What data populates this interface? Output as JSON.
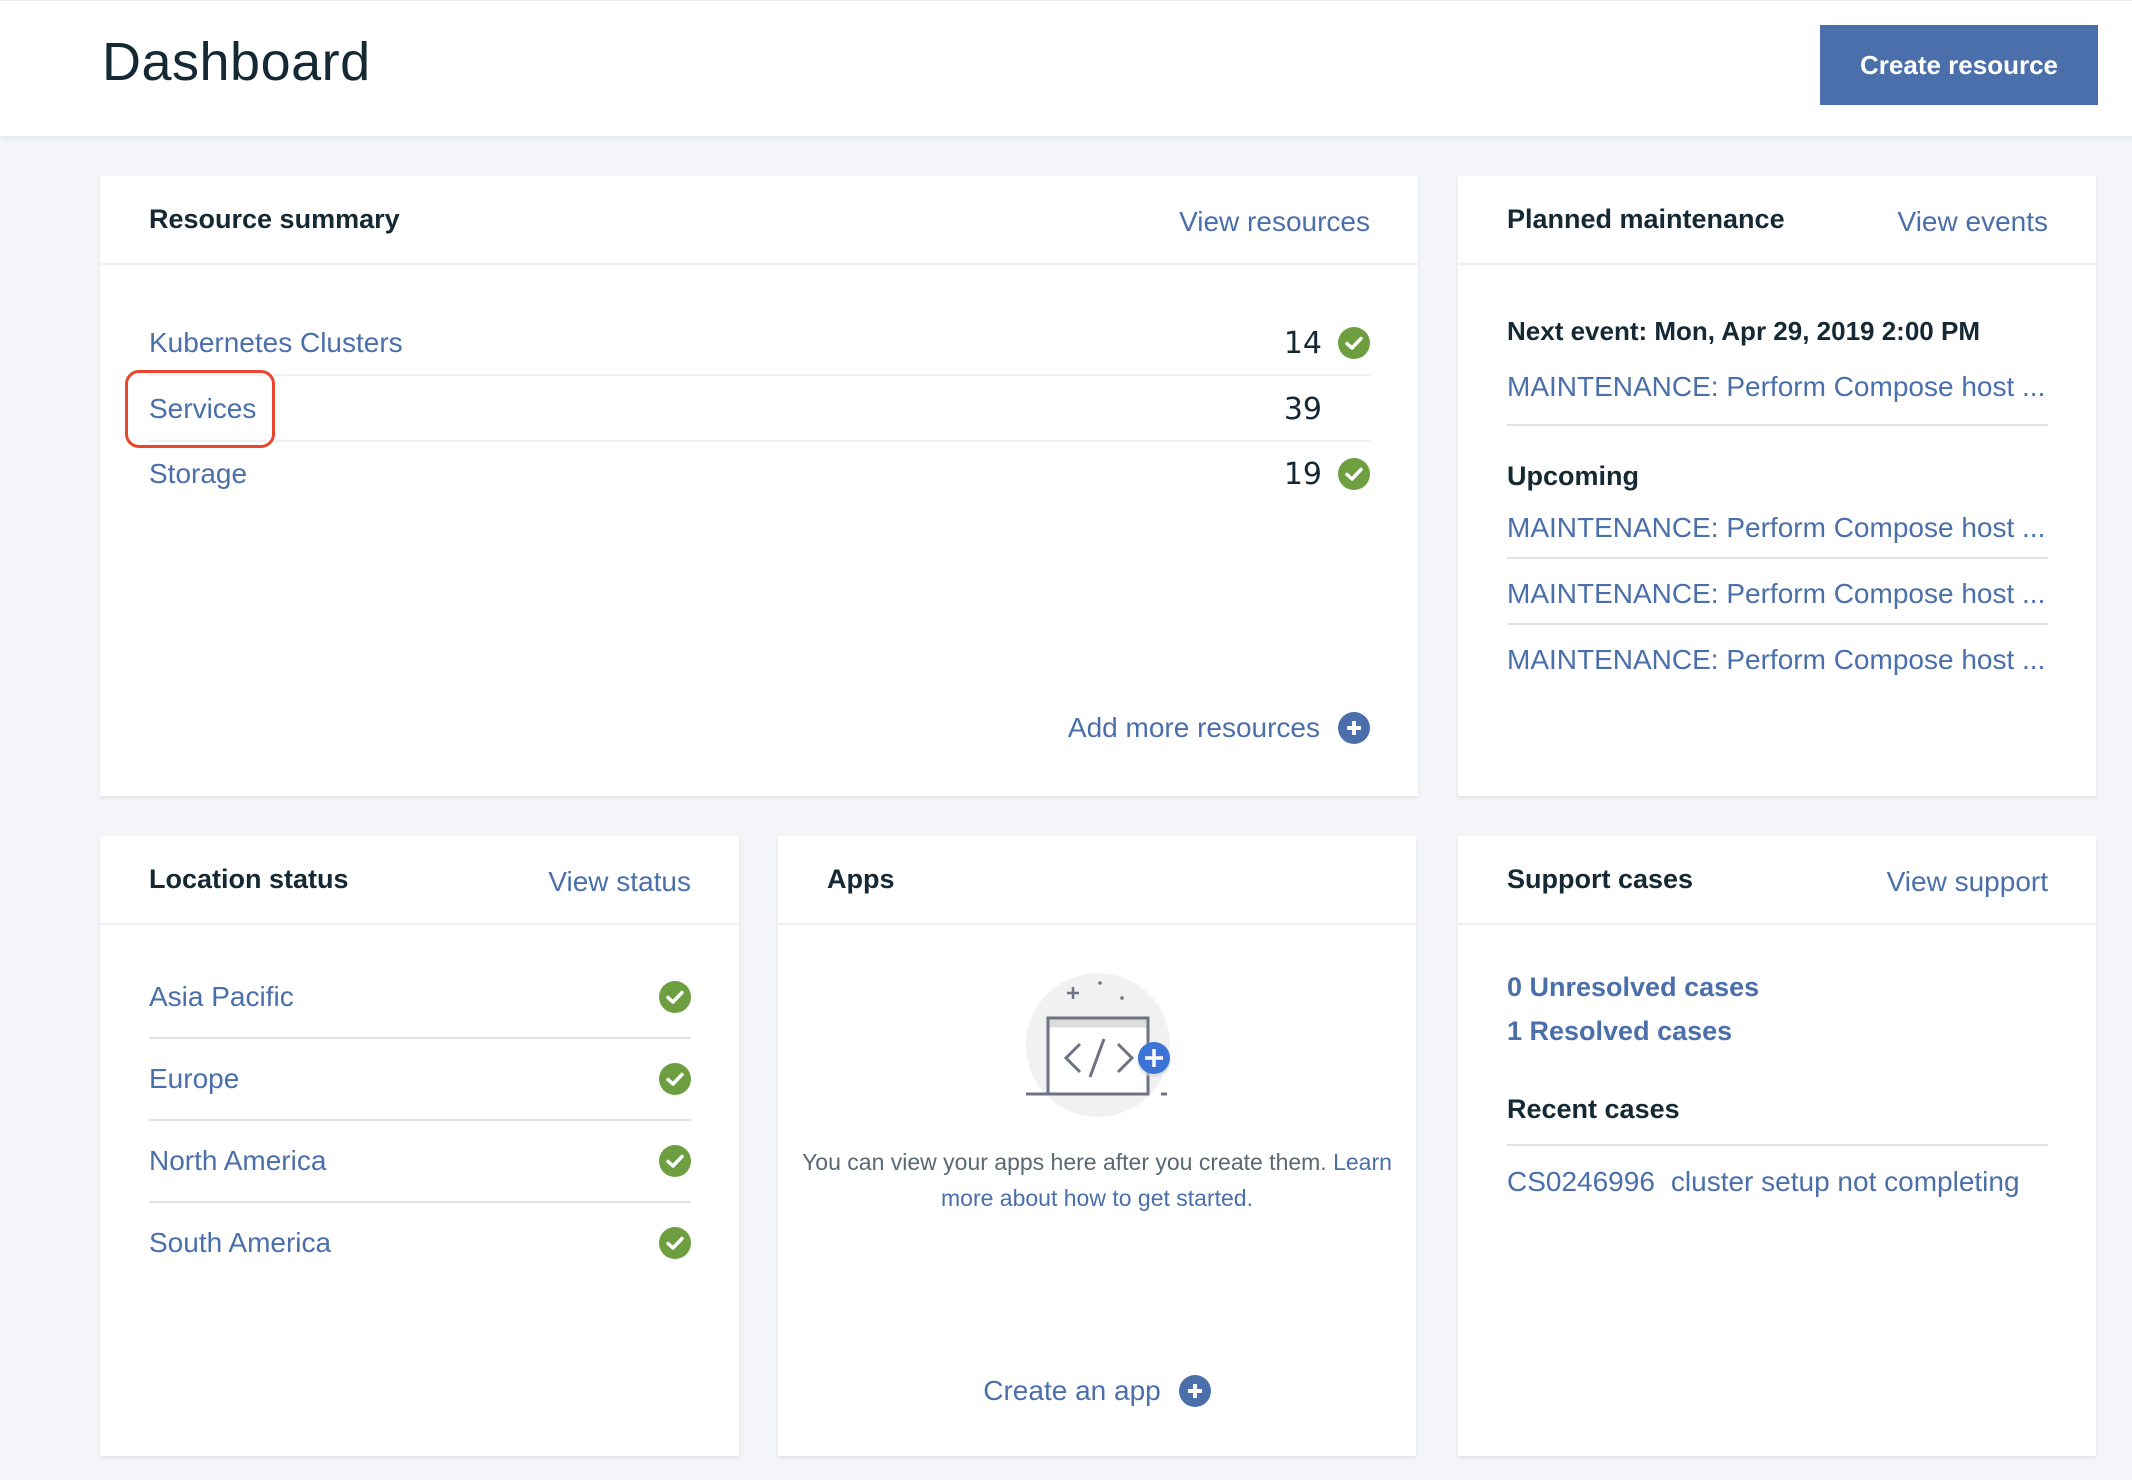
{
  "header": {
    "title": "Dashboard",
    "create_button": "Create resource"
  },
  "colors": {
    "accent": "#4a6fab",
    "success": "#6d9e3f",
    "highlight": "#e8472e",
    "background": "#f3f5f9"
  },
  "resource_summary": {
    "title": "Resource summary",
    "link": "View resources",
    "rows": [
      {
        "name": "Kubernetes Clusters",
        "count": "14",
        "status": "check-icon"
      },
      {
        "name": "Services",
        "count": "39",
        "status": ""
      },
      {
        "name": "Storage",
        "count": "19",
        "status": "check-icon"
      }
    ],
    "add_more": "Add more resources"
  },
  "planned_maintenance": {
    "title": "Planned maintenance",
    "link": "View events",
    "next_event": "Next event: Mon, Apr 29, 2019 2:00 PM",
    "next_item": "MAINTENANCE: Perform Compose host ...",
    "upcoming_label": "Upcoming",
    "upcoming": [
      "MAINTENANCE: Perform Compose host ...",
      "MAINTENANCE: Perform Compose host ...",
      "MAINTENANCE: Perform Compose host ..."
    ]
  },
  "location_status": {
    "title": "Location status",
    "link": "View status",
    "locations": [
      {
        "name": "Asia Pacific",
        "status": "check-icon"
      },
      {
        "name": "Europe",
        "status": "check-icon"
      },
      {
        "name": "North America",
        "status": "check-icon"
      },
      {
        "name": "South America",
        "status": "check-icon"
      }
    ]
  },
  "apps": {
    "title": "Apps",
    "description": "You can view your apps here after you create them.",
    "learn_more": "Learn more about how to get started.",
    "create": "Create an app"
  },
  "support_cases": {
    "title": "Support cases",
    "link": "View support",
    "unresolved": "0 Unresolved cases",
    "resolved": "1 Resolved cases",
    "recent_label": "Recent cases",
    "recent": [
      {
        "id": "CS0246996",
        "subject": "cluster setup not completing"
      }
    ]
  }
}
